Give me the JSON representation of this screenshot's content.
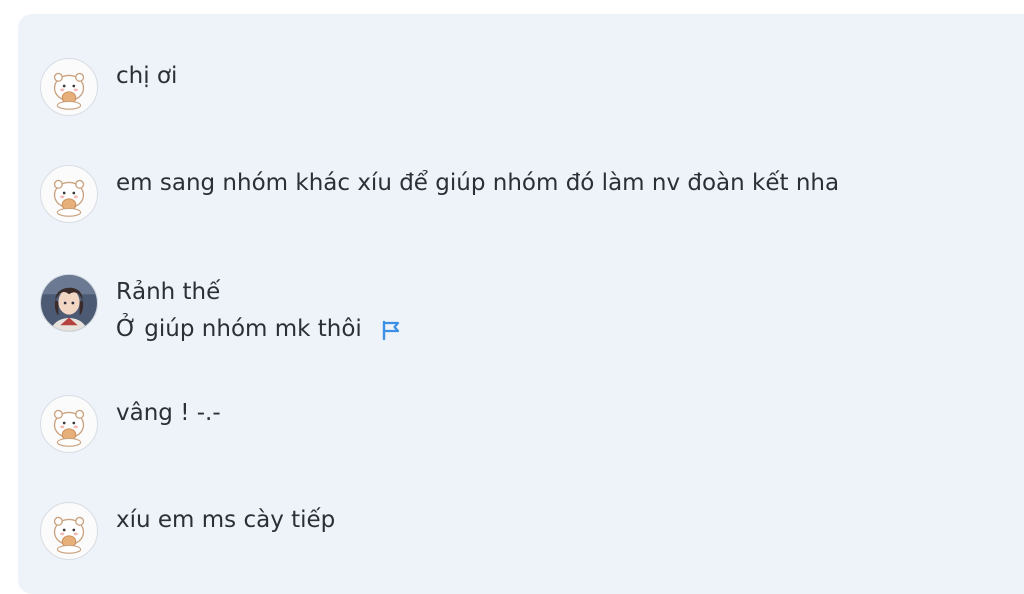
{
  "messages": [
    {
      "sender": "cat-user",
      "avatar_icon": "cat-sticker-avatar-icon",
      "lines": [
        "chị ơi"
      ]
    },
    {
      "sender": "cat-user",
      "avatar_icon": "cat-sticker-avatar-icon",
      "lines": [
        "em sang nhóm khác xíu để giúp nhóm đó làm nv đoàn kết nha"
      ]
    },
    {
      "sender": "anime-user",
      "avatar_icon": "anime-character-avatar-icon",
      "lines": [
        "Rảnh thế",
        "Ở giúp nhóm mk thôi"
      ],
      "reaction_icon": "flag-icon",
      "reaction_color": "#3b8fe6"
    },
    {
      "sender": "cat-user",
      "avatar_icon": "cat-sticker-avatar-icon",
      "lines": [
        "vâng ! -.-"
      ]
    },
    {
      "sender": "cat-user",
      "avatar_icon": "cat-sticker-avatar-icon",
      "lines": [
        "xíu em ms cày tiếp"
      ]
    }
  ],
  "colors": {
    "panel_background": "#eef3f9",
    "text": "#2b2f36",
    "accent": "#3b8fe6"
  }
}
